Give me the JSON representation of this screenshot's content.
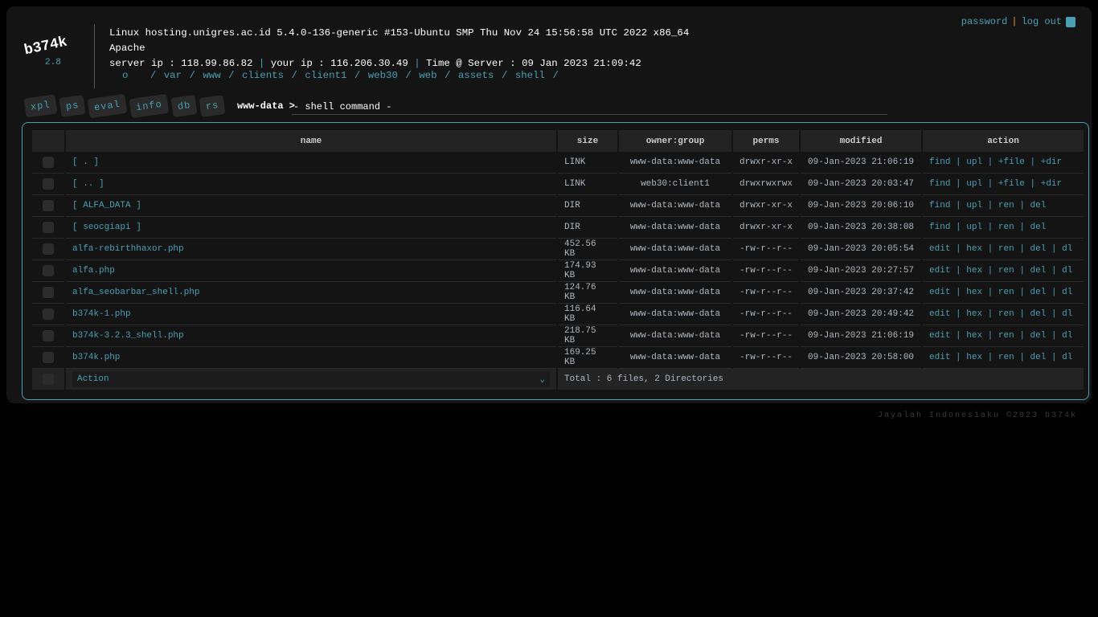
{
  "logo": {
    "name": "b374k",
    "version": "2.8"
  },
  "server": {
    "uname": "Linux hosting.unigres.ac.id 5.4.0-136-generic #153-Ubuntu SMP Thu Nov 24 15:56:58 UTC 2022 x86_64",
    "software": "Apache",
    "server_ip_label": "server ip : 118.99.86.82",
    "your_ip_label": "your ip : 116.206.30.49",
    "time_label": "Time @ Server : 09 Jan 2023 21:09:42"
  },
  "breadcrumb": [
    "o",
    "/",
    "var",
    "/",
    "www",
    "/",
    "clients",
    "/",
    "client1",
    "/",
    "web30",
    "/",
    "web",
    "/",
    "assets",
    "/",
    "shell",
    "/"
  ],
  "top": {
    "password": "password",
    "logout": "log out"
  },
  "tabs": [
    "xpl",
    "ps",
    "eval",
    "info",
    "db",
    "rs"
  ],
  "prompt": {
    "user": "www-data >",
    "value": "- shell command -"
  },
  "table": {
    "headers": [
      "name",
      "size",
      "owner:group",
      "perms",
      "modified",
      "action"
    ],
    "rows": [
      {
        "name": "[ . ]",
        "size": "LINK",
        "owner": "www-data:www-data",
        "perms": "drwxr-xr-x",
        "modified": "09-Jan-2023 21:06:19",
        "actions": [
          "find",
          "upl",
          "+file",
          "+dir"
        ]
      },
      {
        "name": "[ .. ]",
        "size": "LINK",
        "owner": "web30:client1",
        "perms": "drwxrwxrwx",
        "modified": "09-Jan-2023 20:03:47",
        "actions": [
          "find",
          "upl",
          "+file",
          "+dir"
        ]
      },
      {
        "name": "[ ALFA_DATA ]",
        "size": "DIR",
        "owner": "www-data:www-data",
        "perms": "drwxr-xr-x",
        "modified": "09-Jan-2023 20:06:10",
        "actions": [
          "find",
          "upl",
          "ren",
          "del"
        ]
      },
      {
        "name": "[ seocgiapi ]",
        "size": "DIR",
        "owner": "www-data:www-data",
        "perms": "drwxr-xr-x",
        "modified": "09-Jan-2023 20:38:08",
        "actions": [
          "find",
          "upl",
          "ren",
          "del"
        ]
      },
      {
        "name": "alfa-rebirthhaxor.php",
        "size": "452.56 KB",
        "owner": "www-data:www-data",
        "perms": "-rw-r--r--",
        "modified": "09-Jan-2023 20:05:54",
        "actions": [
          "edit",
          "hex",
          "ren",
          "del",
          "dl"
        ]
      },
      {
        "name": "alfa.php",
        "size": "174.93 KB",
        "owner": "www-data:www-data",
        "perms": "-rw-r--r--",
        "modified": "09-Jan-2023 20:27:57",
        "actions": [
          "edit",
          "hex",
          "ren",
          "del",
          "dl"
        ]
      },
      {
        "name": "alfa_seobarbar_shell.php",
        "size": "124.76 KB",
        "owner": "www-data:www-data",
        "perms": "-rw-r--r--",
        "modified": "09-Jan-2023 20:37:42",
        "actions": [
          "edit",
          "hex",
          "ren",
          "del",
          "dl"
        ]
      },
      {
        "name": "b374k-1.php",
        "size": "116.64 KB",
        "owner": "www-data:www-data",
        "perms": "-rw-r--r--",
        "modified": "09-Jan-2023 20:49:42",
        "actions": [
          "edit",
          "hex",
          "ren",
          "del",
          "dl"
        ]
      },
      {
        "name": "b374k-3.2.3_shell.php",
        "size": "218.75 KB",
        "owner": "www-data:www-data",
        "perms": "-rw-r--r--",
        "modified": "09-Jan-2023 21:06:19",
        "actions": [
          "edit",
          "hex",
          "ren",
          "del",
          "dl"
        ]
      },
      {
        "name": "b374k.php",
        "size": "169.25 KB",
        "owner": "www-data:www-data",
        "perms": "-rw-r--r--",
        "modified": "09-Jan-2023 20:58:00",
        "actions": [
          "edit",
          "hex",
          "ren",
          "del",
          "dl"
        ]
      }
    ],
    "action_select": "Action",
    "total": "Total : 6 files, 2 Directories"
  },
  "footer": "Jayalah Indonesiaku ©2023 b374k",
  "colors": {
    "accent": "#4a9fb5",
    "separator": "#e0a030",
    "panel": "#141414"
  }
}
